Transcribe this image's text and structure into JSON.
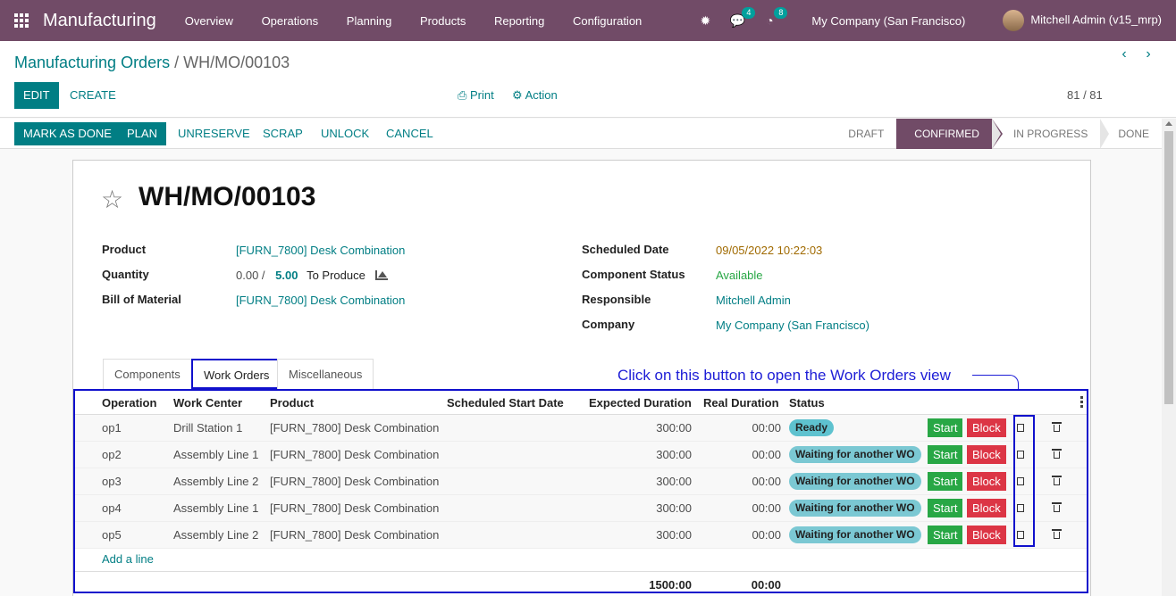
{
  "app": {
    "name": "Manufacturing"
  },
  "menu": [
    "Overview",
    "Operations",
    "Planning",
    "Products",
    "Reporting",
    "Configuration"
  ],
  "systray": {
    "messages_badge": "4",
    "activities_badge": "8",
    "company": "My Company (San Francisco)",
    "user": "Mitchell Admin (v15_mrp)"
  },
  "breadcrumb": {
    "parent": "Manufacturing Orders",
    "separator": "/",
    "current": "WH/MO/00103"
  },
  "buttons": {
    "edit": "EDIT",
    "create": "CREATE",
    "print": "Print",
    "action": "Action"
  },
  "pager": {
    "value": "81 / 81"
  },
  "status_buttons": {
    "mark_done": "MARK AS DONE",
    "plan": "PLAN",
    "unreserve": "UNRESERVE",
    "scrap": "SCRAP",
    "unlock": "UNLOCK",
    "cancel": "CANCEL"
  },
  "stages": {
    "draft": "DRAFT",
    "confirmed": "CONFIRMED",
    "in_progress": "IN PROGRESS",
    "done": "DONE",
    "active": "CONFIRMED"
  },
  "record": {
    "title": "WH/MO/00103",
    "product_label": "Product",
    "product": "[FURN_7800] Desk Combination",
    "quantity_label": "Quantity",
    "qty_done": "0.00 /",
    "qty_total": "5.00",
    "qty_suffix": "To Produce",
    "bom_label": "Bill of Material",
    "bom": "[FURN_7800] Desk Combination",
    "scheduled_label": "Scheduled Date",
    "scheduled": "09/05/2022 10:22:03",
    "component_status_label": "Component Status",
    "component_status": "Available",
    "responsible_label": "Responsible",
    "responsible": "Mitchell Admin",
    "company_label": "Company",
    "company": "My Company (San Francisco)"
  },
  "tabs": {
    "components": "Components",
    "work_orders": "Work Orders",
    "misc": "Miscellaneous"
  },
  "annotation": "Click on this button to open the Work Orders view",
  "workorders": {
    "headers": {
      "operation": "Operation",
      "work_center": "Work Center",
      "product": "Product",
      "start": "Scheduled Start Date",
      "expected": "Expected Duration",
      "real": "Real Duration",
      "status": "Status"
    },
    "rows": [
      {
        "operation": "op1",
        "work_center": "Drill Station 1",
        "product": "[FURN_7800] Desk Combination",
        "start": "",
        "expected": "300:00",
        "real": "00:00",
        "status": "Ready"
      },
      {
        "operation": "op2",
        "work_center": "Assembly Line 1",
        "product": "[FURN_7800] Desk Combination",
        "start": "",
        "expected": "300:00",
        "real": "00:00",
        "status": "Waiting for another WO"
      },
      {
        "operation": "op3",
        "work_center": "Assembly Line 2",
        "product": "[FURN_7800] Desk Combination",
        "start": "",
        "expected": "300:00",
        "real": "00:00",
        "status": "Waiting for another WO"
      },
      {
        "operation": "op4",
        "work_center": "Assembly Line 1",
        "product": "[FURN_7800] Desk Combination",
        "start": "",
        "expected": "300:00",
        "real": "00:00",
        "status": "Waiting for another WO"
      },
      {
        "operation": "op5",
        "work_center": "Assembly Line 2",
        "product": "[FURN_7800] Desk Combination",
        "start": "",
        "expected": "300:00",
        "real": "00:00",
        "status": "Waiting for another WO"
      }
    ],
    "start_label": "Start",
    "block_label": "Block",
    "add_line": "Add a line",
    "total_expected": "1500:00",
    "total_real": "00:00"
  }
}
